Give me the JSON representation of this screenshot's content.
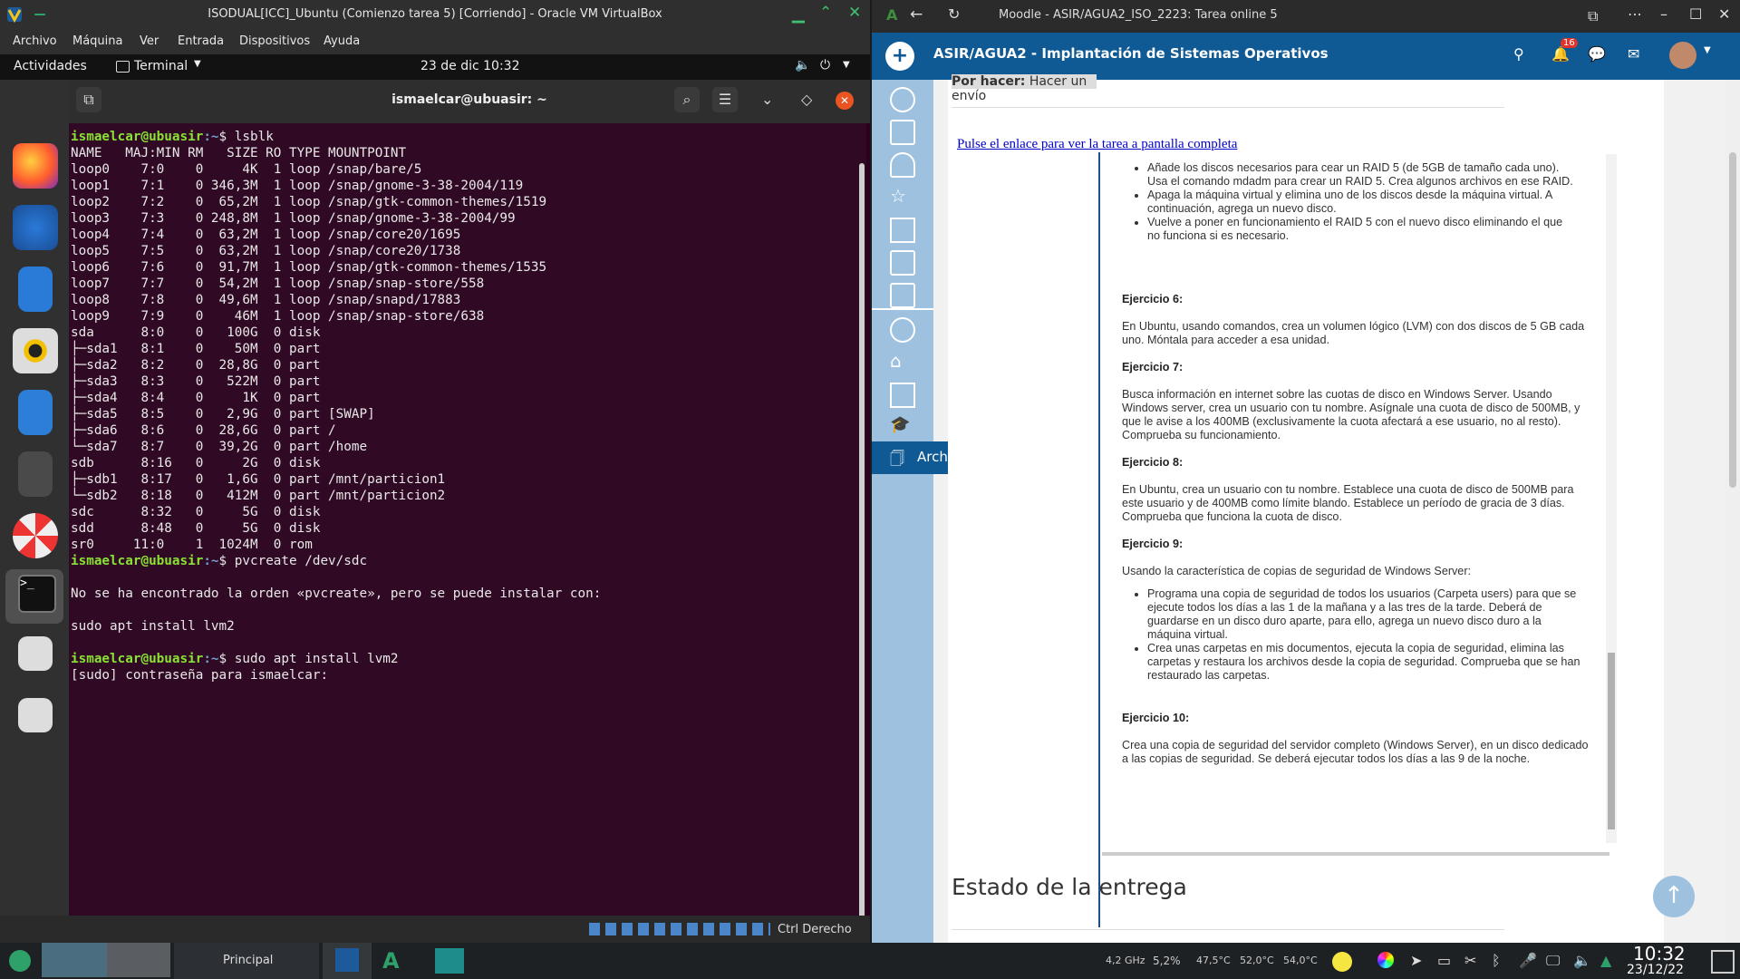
{
  "vbox": {
    "title": "ISODUAL[ICC]_Ubuntu (Comienzo tarea 5) [Corriendo] - Oracle VM VirtualBox",
    "menu": [
      "Archivo",
      "Máquina",
      "Ver",
      "Entrada",
      "Dispositivos",
      "Ayuda"
    ],
    "status_host_key": "Ctrl Derecho"
  },
  "gnome": {
    "activities": "Actividades",
    "app_menu": "Terminal",
    "clock": "23 de dic  10:32"
  },
  "terminal": {
    "title": "ismaelcar@ubuasir: ~",
    "prompt_user": "ismaelcar@ubuasir",
    "prompt_path": ":~",
    "cmd1": "$ lsblk",
    "lsblk_output": "NAME   MAJ:MIN RM   SIZE RO TYPE MOUNTPOINT\nloop0    7:0    0     4K  1 loop /snap/bare/5\nloop1    7:1    0 346,3M  1 loop /snap/gnome-3-38-2004/119\nloop2    7:2    0  65,2M  1 loop /snap/gtk-common-themes/1519\nloop3    7:3    0 248,8M  1 loop /snap/gnome-3-38-2004/99\nloop4    7:4    0  63,2M  1 loop /snap/core20/1695\nloop5    7:5    0  63,2M  1 loop /snap/core20/1738\nloop6    7:6    0  91,7M  1 loop /snap/gtk-common-themes/1535\nloop7    7:7    0  54,2M  1 loop /snap/snap-store/558\nloop8    7:8    0  49,6M  1 loop /snap/snapd/17883\nloop9    7:9    0    46M  1 loop /snap/snap-store/638\nsda      8:0    0   100G  0 disk\n├─sda1   8:1    0    50M  0 part\n├─sda2   8:2    0  28,8G  0 part\n├─sda3   8:3    0   522M  0 part\n├─sda4   8:4    0     1K  0 part\n├─sda5   8:5    0   2,9G  0 part [SWAP]\n├─sda6   8:6    0  28,6G  0 part /\n└─sda7   8:7    0  39,2G  0 part /home\nsdb      8:16   0     2G  0 disk\n├─sdb1   8:17   0   1,6G  0 part /mnt/particion1\n└─sdb2   8:18   0   412M  0 part /mnt/particion2\nsdc      8:32   0     5G  0 disk\nsdd      8:48   0     5G  0 disk\nsr0     11:0    1  1024M  0 rom",
    "cmd2": "$ pvcreate /dev/sdc",
    "output2": "\nNo se ha encontrado la orden «pvcreate», pero se puede instalar con:\n\nsudo apt install lvm2\n",
    "cmd3": "$ sudo apt install lvm2",
    "output3": "[sudo] contraseña para ismaelcar: "
  },
  "browser": {
    "tab_title": "Moodle - ASIR/AGUA2_ISO_2223: Tarea online 5",
    "course_title": "ASIR/AGUA2 - Implantación de Sistemas Operativos",
    "notif_count": "16",
    "drawer_private_files": "Archivos privados",
    "por_hacer_label": "Por hacer:",
    "por_hacer_value": "Hacer un envío",
    "fullscreen_link": "Pulse el enlace para ver la tarea a pantalla completa",
    "bullets_top": [
      "Añade los discos necesarios para cear un RAID 5 (de 5GB de tamaño cada uno). Usa el comando mdadm para crear un RAID 5.  Crea algunos archivos en ese RAID.",
      "Apaga la máquina virtual y elimina uno de los discos desde la máquina virtual. A continuación, agrega un nuevo disco.",
      "Vuelve a poner en funcionamiento el RAID 5 con el nuevo disco eliminando el que no funciona si es necesario."
    ],
    "ej6_title": "Ejercicio 6:",
    "ej6_text": "En Ubuntu, usando comandos, crea un volumen lógico (LVM) con dos discos de 5 GB cada uno.  Móntala para acceder a esa unidad.",
    "ej7_title": "Ejercicio 7:",
    "ej7_text": "Busca información en internet sobre las cuotas de disco en Windows Server.  Usando Windows server, crea un usuario con tu nombre.  Asígnale una cuota de disco de 500MB, y que le avise a los 400MB (exclusivamente la cuota afectará a ese usuario, no al resto).  Comprueba su funcionamiento.",
    "ej8_title": "Ejercicio 8:",
    "ej8_text": "En Ubuntu, crea un usuario con tu nombre.  Establece una cuota de disco de 500MB para este usuario y de 400MB como límite blando.  Establece un período de gracia de 3 días.  Comprueba que funciona la cuota de disco.",
    "ej9_title": "Ejercicio 9:",
    "ej9_text": "Usando la característica de copias de seguridad de Windows Server:",
    "ej9_bullets": [
      "Programa una copia de seguridad de todos los usuarios (Carpeta users) para que se ejecute todos los días a las 1 de la mañana y a las tres de la tarde.  Deberá de guardarse en un disco duro aparte, para ello, agrega un nuevo disco duro a la máquina virtual.",
      "Crea unas carpetas en mis documentos, ejecuta la copia de seguridad, elimina las carpetas y restaura los archivos desde la copia de seguridad. Comprueba que se han restaurado las carpetas."
    ],
    "ej10_title": "Ejercicio 10:",
    "ej10_text": "Crea una copia de seguridad del servidor completo (Windows Server), en un disco dedicado a las copias de seguridad.  Se deberá ejecutar todos los días a las 9 de la noche.",
    "estado_heading": "Estado de la entrega"
  },
  "taskbar": {
    "principal": "Principal",
    "cpu_freq": "4,2 GHz",
    "cpu_load": "5,2%",
    "temp1": "47,5°C",
    "temp2": "52,0°C",
    "temp3": "54,0°C",
    "time": "10:32",
    "date": "23/12/22"
  },
  "colors": {
    "moodle_nav": "#0f5a94",
    "moodle_drawer": "#9ec1e0",
    "terminal_bg": "#300a24",
    "prompt_user": "#8ae234",
    "prompt_path": "#729fcf"
  }
}
